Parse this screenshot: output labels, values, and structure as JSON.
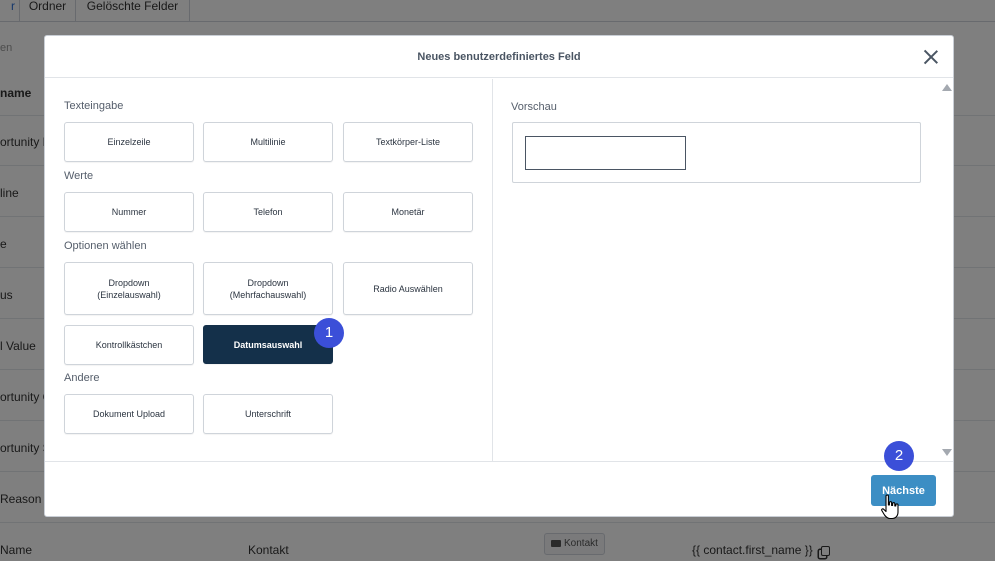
{
  "background": {
    "tabs": [
      "r",
      "Ordner",
      "Gelöschte Felder"
    ],
    "search_placeholder": "en",
    "header_col": "name",
    "rows": [
      "ortunity N",
      "line",
      "e",
      "us",
      "l Value",
      "ortunity O",
      "ortunity S",
      "Reason"
    ],
    "last_row": {
      "name": "Name",
      "object": "Kontakt",
      "folder": "Kontakt",
      "merge_field": "{{ contact.first_name }}"
    }
  },
  "modal": {
    "title": "Neues benutzerdefiniertes Feld",
    "sections": {
      "text_input": "Texteingabe",
      "values": "Werte",
      "options": "Optionen wählen",
      "other": "Andere"
    },
    "buttons": {
      "single_line": "Einzelzeile",
      "multi_line": "Multilinie",
      "text_box_list": "Textkörper-Liste",
      "number": "Nummer",
      "phone": "Telefon",
      "monetary": "Monetär",
      "dropdown_single": "Dropdown\n(Einzelauswahl)",
      "dropdown_multi": "Dropdown\n(Mehrfachauswahl)",
      "radio_select": "Radio Auswählen",
      "checkboxes": "Kontrollkästchen",
      "date_picker": "Datumsauswahl",
      "file_upload": "Dokument Upload",
      "signature": "Unterschrift"
    },
    "selected": "date_picker",
    "preview_label": "Vorschau",
    "next_label": "Nächste"
  },
  "annotations": {
    "step1": "1",
    "step2": "2",
    "color": "#3b4fd8"
  },
  "colors": {
    "selected_button": "#14304a",
    "next_button": "#3c8ec4"
  }
}
